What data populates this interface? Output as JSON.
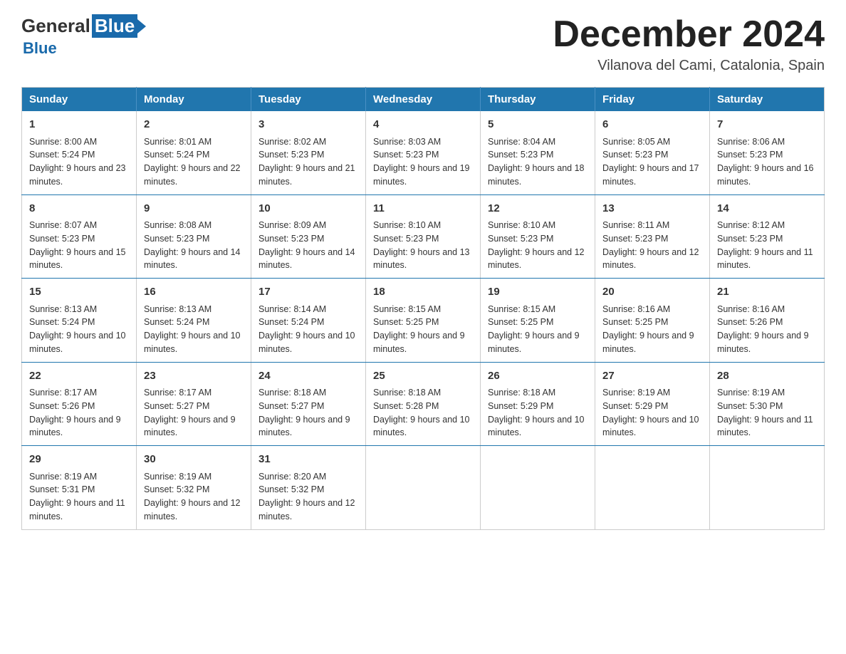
{
  "header": {
    "logo_general": "General",
    "logo_blue": "Blue",
    "month_title": "December 2024",
    "subtitle": "Vilanova del Cami, Catalonia, Spain"
  },
  "days_of_week": [
    "Sunday",
    "Monday",
    "Tuesday",
    "Wednesday",
    "Thursday",
    "Friday",
    "Saturday"
  ],
  "weeks": [
    [
      {
        "day": "1",
        "sunrise": "Sunrise: 8:00 AM",
        "sunset": "Sunset: 5:24 PM",
        "daylight": "Daylight: 9 hours and 23 minutes."
      },
      {
        "day": "2",
        "sunrise": "Sunrise: 8:01 AM",
        "sunset": "Sunset: 5:24 PM",
        "daylight": "Daylight: 9 hours and 22 minutes."
      },
      {
        "day": "3",
        "sunrise": "Sunrise: 8:02 AM",
        "sunset": "Sunset: 5:23 PM",
        "daylight": "Daylight: 9 hours and 21 minutes."
      },
      {
        "day": "4",
        "sunrise": "Sunrise: 8:03 AM",
        "sunset": "Sunset: 5:23 PM",
        "daylight": "Daylight: 9 hours and 19 minutes."
      },
      {
        "day": "5",
        "sunrise": "Sunrise: 8:04 AM",
        "sunset": "Sunset: 5:23 PM",
        "daylight": "Daylight: 9 hours and 18 minutes."
      },
      {
        "day": "6",
        "sunrise": "Sunrise: 8:05 AM",
        "sunset": "Sunset: 5:23 PM",
        "daylight": "Daylight: 9 hours and 17 minutes."
      },
      {
        "day": "7",
        "sunrise": "Sunrise: 8:06 AM",
        "sunset": "Sunset: 5:23 PM",
        "daylight": "Daylight: 9 hours and 16 minutes."
      }
    ],
    [
      {
        "day": "8",
        "sunrise": "Sunrise: 8:07 AM",
        "sunset": "Sunset: 5:23 PM",
        "daylight": "Daylight: 9 hours and 15 minutes."
      },
      {
        "day": "9",
        "sunrise": "Sunrise: 8:08 AM",
        "sunset": "Sunset: 5:23 PM",
        "daylight": "Daylight: 9 hours and 14 minutes."
      },
      {
        "day": "10",
        "sunrise": "Sunrise: 8:09 AM",
        "sunset": "Sunset: 5:23 PM",
        "daylight": "Daylight: 9 hours and 14 minutes."
      },
      {
        "day": "11",
        "sunrise": "Sunrise: 8:10 AM",
        "sunset": "Sunset: 5:23 PM",
        "daylight": "Daylight: 9 hours and 13 minutes."
      },
      {
        "day": "12",
        "sunrise": "Sunrise: 8:10 AM",
        "sunset": "Sunset: 5:23 PM",
        "daylight": "Daylight: 9 hours and 12 minutes."
      },
      {
        "day": "13",
        "sunrise": "Sunrise: 8:11 AM",
        "sunset": "Sunset: 5:23 PM",
        "daylight": "Daylight: 9 hours and 12 minutes."
      },
      {
        "day": "14",
        "sunrise": "Sunrise: 8:12 AM",
        "sunset": "Sunset: 5:23 PM",
        "daylight": "Daylight: 9 hours and 11 minutes."
      }
    ],
    [
      {
        "day": "15",
        "sunrise": "Sunrise: 8:13 AM",
        "sunset": "Sunset: 5:24 PM",
        "daylight": "Daylight: 9 hours and 10 minutes."
      },
      {
        "day": "16",
        "sunrise": "Sunrise: 8:13 AM",
        "sunset": "Sunset: 5:24 PM",
        "daylight": "Daylight: 9 hours and 10 minutes."
      },
      {
        "day": "17",
        "sunrise": "Sunrise: 8:14 AM",
        "sunset": "Sunset: 5:24 PM",
        "daylight": "Daylight: 9 hours and 10 minutes."
      },
      {
        "day": "18",
        "sunrise": "Sunrise: 8:15 AM",
        "sunset": "Sunset: 5:25 PM",
        "daylight": "Daylight: 9 hours and 9 minutes."
      },
      {
        "day": "19",
        "sunrise": "Sunrise: 8:15 AM",
        "sunset": "Sunset: 5:25 PM",
        "daylight": "Daylight: 9 hours and 9 minutes."
      },
      {
        "day": "20",
        "sunrise": "Sunrise: 8:16 AM",
        "sunset": "Sunset: 5:25 PM",
        "daylight": "Daylight: 9 hours and 9 minutes."
      },
      {
        "day": "21",
        "sunrise": "Sunrise: 8:16 AM",
        "sunset": "Sunset: 5:26 PM",
        "daylight": "Daylight: 9 hours and 9 minutes."
      }
    ],
    [
      {
        "day": "22",
        "sunrise": "Sunrise: 8:17 AM",
        "sunset": "Sunset: 5:26 PM",
        "daylight": "Daylight: 9 hours and 9 minutes."
      },
      {
        "day": "23",
        "sunrise": "Sunrise: 8:17 AM",
        "sunset": "Sunset: 5:27 PM",
        "daylight": "Daylight: 9 hours and 9 minutes."
      },
      {
        "day": "24",
        "sunrise": "Sunrise: 8:18 AM",
        "sunset": "Sunset: 5:27 PM",
        "daylight": "Daylight: 9 hours and 9 minutes."
      },
      {
        "day": "25",
        "sunrise": "Sunrise: 8:18 AM",
        "sunset": "Sunset: 5:28 PM",
        "daylight": "Daylight: 9 hours and 10 minutes."
      },
      {
        "day": "26",
        "sunrise": "Sunrise: 8:18 AM",
        "sunset": "Sunset: 5:29 PM",
        "daylight": "Daylight: 9 hours and 10 minutes."
      },
      {
        "day": "27",
        "sunrise": "Sunrise: 8:19 AM",
        "sunset": "Sunset: 5:29 PM",
        "daylight": "Daylight: 9 hours and 10 minutes."
      },
      {
        "day": "28",
        "sunrise": "Sunrise: 8:19 AM",
        "sunset": "Sunset: 5:30 PM",
        "daylight": "Daylight: 9 hours and 11 minutes."
      }
    ],
    [
      {
        "day": "29",
        "sunrise": "Sunrise: 8:19 AM",
        "sunset": "Sunset: 5:31 PM",
        "daylight": "Daylight: 9 hours and 11 minutes."
      },
      {
        "day": "30",
        "sunrise": "Sunrise: 8:19 AM",
        "sunset": "Sunset: 5:32 PM",
        "daylight": "Daylight: 9 hours and 12 minutes."
      },
      {
        "day": "31",
        "sunrise": "Sunrise: 8:20 AM",
        "sunset": "Sunset: 5:32 PM",
        "daylight": "Daylight: 9 hours and 12 minutes."
      },
      null,
      null,
      null,
      null
    ]
  ]
}
